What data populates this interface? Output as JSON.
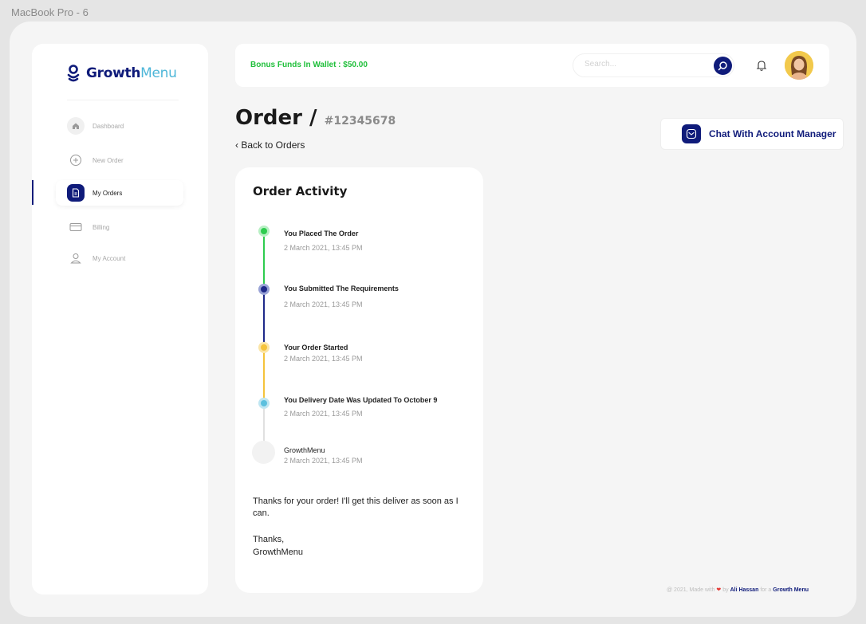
{
  "frame_label": "MacBook Pro - 6",
  "brand": {
    "name_primary": "Growth",
    "name_accent": "Menu"
  },
  "sidebar": {
    "items": [
      {
        "label": "Dashboard",
        "icon": "home-icon"
      },
      {
        "label": "New Order",
        "icon": "plus-circle-icon"
      },
      {
        "label": "My Orders",
        "icon": "orders-icon",
        "active": true
      },
      {
        "label": "Billing",
        "icon": "card-icon"
      },
      {
        "label": "My Account",
        "icon": "user-icon"
      }
    ]
  },
  "topbar": {
    "bonus_text": "Bonus Funds In Wallet : $50.00",
    "search_placeholder": "Search..."
  },
  "header": {
    "title": "Order /",
    "order_id": "#12345678",
    "back_link": "‹ Back to Orders",
    "chat_button": "Chat With Account Manager"
  },
  "activity": {
    "title": "Order Activity",
    "events": [
      {
        "title": "You Placed The Order",
        "date": "2 March 2021, 13:45 PM",
        "color": "#2ecc4f"
      },
      {
        "title": "You Submitted The Requirements",
        "date": "2 March 2021, 13:45 PM",
        "color": "#1f2a8a"
      },
      {
        "title": "Your Order Started",
        "date": "2 March 2021, 13:45 PM",
        "color": "#f5c33b"
      },
      {
        "title": "You Delivery Date Was Updated To October 9",
        "date": "2 March 2021, 13:45 PM",
        "color": "#5bc0de"
      },
      {
        "title": "GrowthMenu",
        "date": "2 March 2021, 13:45 PM",
        "color": "#f2f2f2"
      }
    ],
    "message": "Thanks for your order! I'll get this deliver as soon as I can.",
    "signoff_line1": "Thanks,",
    "signoff_line2": "GrowthMenu"
  },
  "footer": {
    "prefix": "@ 2021, Made with",
    "by": "by",
    "author": "Ali Hassan",
    "for": "for a",
    "company": "Growth Menu"
  },
  "colors": {
    "brand": "#0f1b7a",
    "accent": "#4db6d8",
    "success": "#1fbf3a"
  }
}
